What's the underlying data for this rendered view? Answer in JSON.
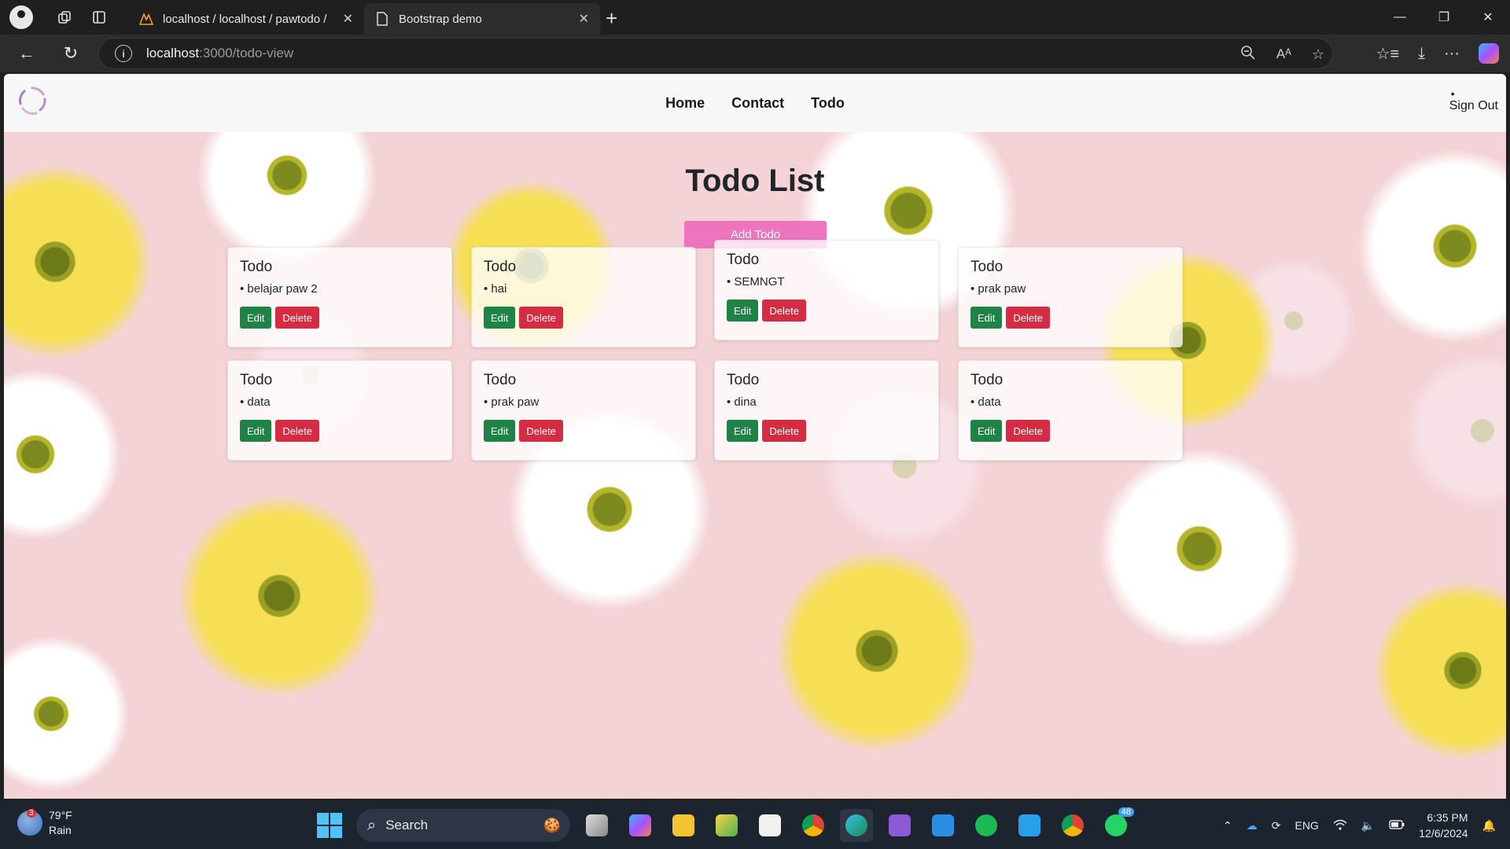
{
  "browser": {
    "tabs": [
      {
        "title": "localhost / localhost / pawtodo / ",
        "icon": "phpmyadmin-icon"
      },
      {
        "title": "Bootstrap demo",
        "icon": "page-icon"
      }
    ],
    "url_host": "localhost",
    "url_path": ":3000/todo-view"
  },
  "navbar": {
    "links": [
      "Home",
      "Contact",
      "Todo"
    ],
    "signout_dot": "•",
    "signout_label": "Sign Out"
  },
  "page": {
    "title": "Todo List",
    "add_button": "Add Todo"
  },
  "todos": [
    {
      "title": "Todo",
      "item": "• belajar paw 2",
      "edit": "Edit",
      "delete": "Delete"
    },
    {
      "title": "Todo",
      "item": "• hai",
      "edit": "Edit",
      "delete": "Delete"
    },
    {
      "title": "Todo",
      "item": "• SEMNGT",
      "edit": "Edit",
      "delete": "Delete"
    },
    {
      "title": "Todo",
      "item": "• prak paw",
      "edit": "Edit",
      "delete": "Delete"
    },
    {
      "title": "Todo",
      "item": "• data",
      "edit": "Edit",
      "delete": "Delete"
    },
    {
      "title": "Todo",
      "item": "• prak paw",
      "edit": "Edit",
      "delete": "Delete"
    },
    {
      "title": "Todo",
      "item": "• dina",
      "edit": "Edit",
      "delete": "Delete"
    },
    {
      "title": "Todo",
      "item": "• data",
      "edit": "Edit",
      "delete": "Delete"
    }
  ],
  "taskbar": {
    "weather_temp": "79°F",
    "weather_desc": "Rain",
    "weather_badge": "3",
    "search_label": "Search",
    "whatsapp_badge": "48",
    "language": "ENG",
    "time": "6:35 PM",
    "date": "12/6/2024"
  },
  "colors": {
    "accent_button": "#ee74be",
    "edit_button": "#1f8348",
    "delete_button": "#d42c43",
    "page_background": "#f3d3d5"
  }
}
